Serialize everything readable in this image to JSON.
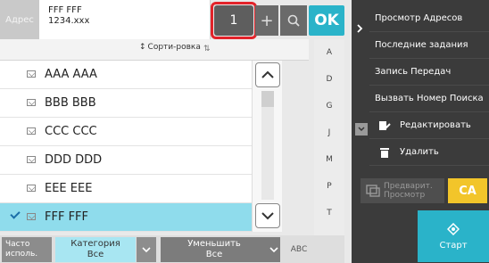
{
  "address": {
    "label": "Адрес",
    "line1": "FFF FFF",
    "line2": "1234.xxx"
  },
  "toolbar": {
    "count": "1",
    "plus": "+",
    "ok": "OK"
  },
  "sort": {
    "label": "Сорти-ровка"
  },
  "list": [
    {
      "name": "AAA AAA",
      "selected": false
    },
    {
      "name": "BBB BBB",
      "selected": false
    },
    {
      "name": "CCC CCC",
      "selected": false
    },
    {
      "name": "DDD DDD",
      "selected": false
    },
    {
      "name": "EEE EEE",
      "selected": false
    },
    {
      "name": "FFF FFF",
      "selected": true
    }
  ],
  "alphabet": [
    "A",
    "D",
    "G",
    "J",
    "M",
    "P",
    "T",
    "W"
  ],
  "bottom": {
    "freq_label": "Часто исполь.",
    "category_label": "Категория",
    "category_value": "Все",
    "reduce_label": "Уменьшить",
    "reduce_value": "Все",
    "abc_label": "ABC"
  },
  "menu": [
    {
      "label": "Просмотр Адресов",
      "icon": ""
    },
    {
      "label": "Последние задания",
      "icon": ""
    },
    {
      "label": "Запись Передач",
      "icon": ""
    },
    {
      "label": "Вызвать Номер Поиска",
      "icon": ""
    },
    {
      "label": "Редактировать",
      "icon": "edit-icon"
    },
    {
      "label": "Удалить",
      "icon": "trash-icon"
    }
  ],
  "preview": {
    "label_line1": "Предварит.",
    "label_line2": "Просмотр"
  },
  "ca": "CA",
  "start": "Старт",
  "colors": {
    "accent": "#2ab3c9",
    "selection": "#8fdcec",
    "highlight": "#e2232a",
    "ca": "#f2c52a"
  }
}
